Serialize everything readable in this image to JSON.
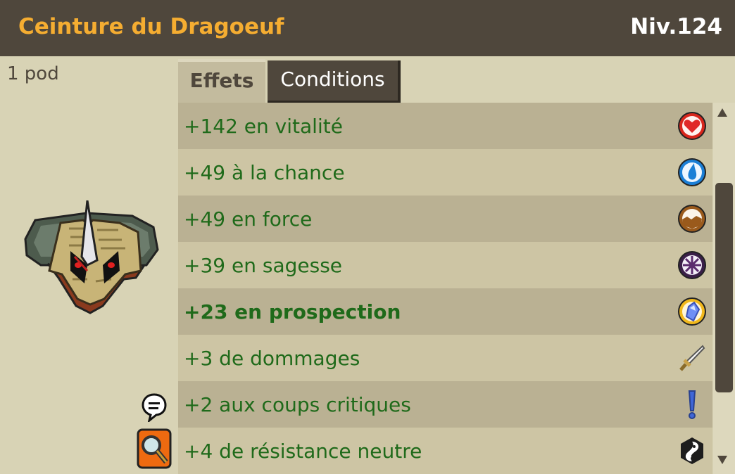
{
  "header": {
    "title": "Ceinture du Dragoeuf",
    "level": "Niv.124"
  },
  "item": {
    "weight": "1 pod",
    "image": "dragoeuf-belt-image"
  },
  "tabs": [
    {
      "label": "Effets",
      "active": true
    },
    {
      "label": "Conditions",
      "active": false
    }
  ],
  "effects": [
    {
      "text": "+142 en vitalité",
      "icon": "vitality-heart-icon",
      "color": "#d8261c"
    },
    {
      "text": "+49 à la chance",
      "icon": "chance-water-drop-icon",
      "color": "#1b7fd6"
    },
    {
      "text": "+49 en force",
      "icon": "strength-earth-icon",
      "color": "#9a5a1c"
    },
    {
      "text": "+39 en sagesse",
      "icon": "wisdom-wheel-icon",
      "color": "#5b2c6e"
    },
    {
      "text": "+23 en prospection",
      "icon": "prospecting-crystal-icon",
      "color": "#f1b81c",
      "bold": true
    },
    {
      "text": "+3 de dommages",
      "icon": "damage-sword-icon",
      "color": "#c9a24a"
    },
    {
      "text": "+2 aux coups critiques",
      "icon": "critical-exclamation-icon",
      "color": "#3f66d8"
    },
    {
      "text": "+4 de résistance neutre",
      "icon": "neutral-resistance-icon",
      "color": "#1d1d1d"
    }
  ],
  "colors": {
    "header_bg": "#4f473c",
    "title": "#f5ad31",
    "effect_text": "#1f6a1a",
    "panel_bg": "#d8d3b5"
  },
  "buttons": {
    "chat": "chat-bubble-icon",
    "inspect": "magnifier-icon"
  }
}
